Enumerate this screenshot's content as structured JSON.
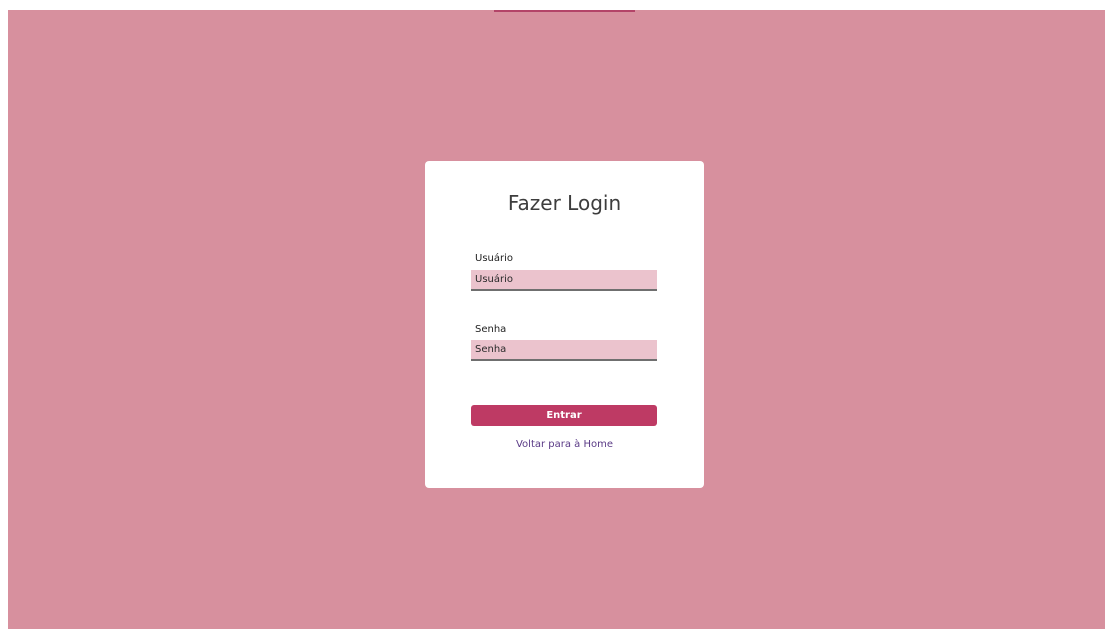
{
  "login": {
    "title": "Fazer Login",
    "user_label": "Usuário",
    "user_placeholder": "Usuário",
    "password_label": "Senha",
    "password_placeholder": "Senha",
    "submit_label": "Entrar",
    "home_link": "Voltar para à Home"
  },
  "colors": {
    "page_background": "#d7909e",
    "card_background": "#ffffff",
    "input_background": "#ebc3cd",
    "button": "#be3a64",
    "link": "#5a3a86"
  }
}
